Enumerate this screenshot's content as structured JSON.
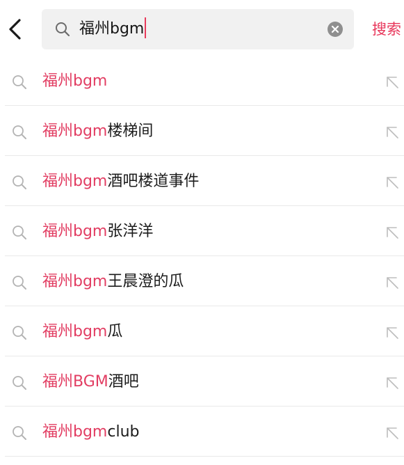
{
  "search": {
    "query": "福州bgm",
    "submit_label": "搜索"
  },
  "colors": {
    "accent": "#e23d62",
    "text": "#1c1c1c",
    "icon_gray": "#b3b3b3",
    "search_bg": "#f1f1f1"
  },
  "icons": {
    "back": "chevron-left-icon",
    "search": "magnifier-icon",
    "clear": "clear-circle-x-icon",
    "fill": "arrow-up-left-icon"
  },
  "suggestions": [
    {
      "highlight": "福州bgm",
      "rest": ""
    },
    {
      "highlight": "福州bgm",
      "rest": "楼梯间"
    },
    {
      "highlight": "福州bgm",
      "rest": "酒吧楼道事件"
    },
    {
      "highlight": "福州bgm",
      "rest": "张洋洋"
    },
    {
      "highlight": "福州bgm",
      "rest": "王晨澄的瓜"
    },
    {
      "highlight": "福州bgm",
      "rest": "瓜"
    },
    {
      "highlight": "福州BGM",
      "rest": "酒吧"
    },
    {
      "highlight": "福州bgm",
      "rest": "club"
    }
  ]
}
